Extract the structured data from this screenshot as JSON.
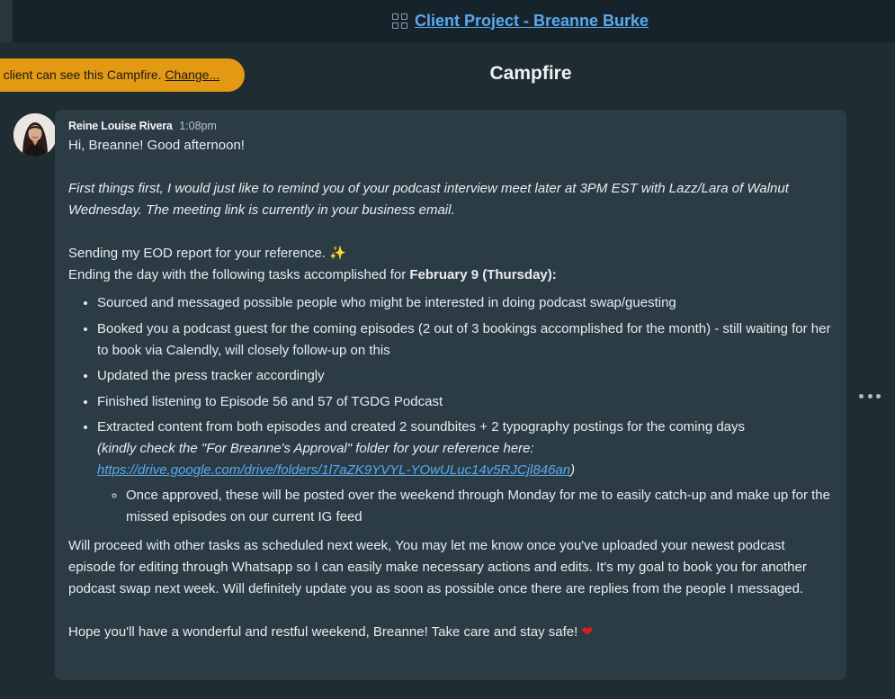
{
  "header": {
    "project_title": "Client Project - Breanne Burke",
    "grid_icon": "grid-icon"
  },
  "banner": {
    "visibility_text": "e client can see this Campfire. ",
    "change_label": "Change...",
    "color": "#e39a12"
  },
  "page": {
    "title": "Campfire"
  },
  "message": {
    "author": "Reine Louise Rivera",
    "time": "1:08pm",
    "greeting": "Hi, Breanne! Good afternoon!",
    "reminder": "First things first, I would just like to remind you of your podcast interview meet later at 3PM EST with Lazz/Lara of Walnut Wednesday. The meeting link is currently in your business email.",
    "eod_line": "Sending my EOD report for your reference. ",
    "sparkle_emoji": "✨",
    "tasks_intro": "Ending the day with the following tasks accomplished for ",
    "tasks_date": "February 9 (Thursday):",
    "tasks": [
      "Sourced and messaged possible people who might be interested in doing podcast swap/guesting",
      "Booked you a podcast guest for the coming episodes (2 out of 3 bookings accomplished for the month) - still waiting for her to book via Calendly, will closely follow-up on this",
      "Updated the press tracker accordingly",
      "Finished listening to Episode 56 and 57 of TGDG Podcast",
      "Extracted content from both episodes and created 2 soundbites + 2 typography postings for the coming days"
    ],
    "folder_note": "(kindly check the \"For Breanne's Approval\" folder for your reference here:",
    "folder_link": "https://drive.google.com/drive/folders/1l7aZK9YVYL-YOwULuc14v5RJCjl846an",
    "folder_note_close": ")",
    "subtask": "Once approved, these will be posted over the weekend through Monday for me to easily catch-up and make up for the missed episodes on our current IG feed",
    "closing_paragraph": "Will proceed with other tasks as scheduled next week, You may let me know once you've uploaded your newest podcast episode for editing through Whatsapp so I can easily make necessary actions and edits. It's my goal to book you for another podcast swap next week. Will definitely update you as soon as possible once there are replies from the people I messaged.",
    "signoff": "Hope you'll have a wonderful and restful weekend, Breanne! Take care and stay safe! ",
    "heart_emoji": "❤"
  },
  "actions": {
    "more_icon": "more-horizontal-icon"
  }
}
